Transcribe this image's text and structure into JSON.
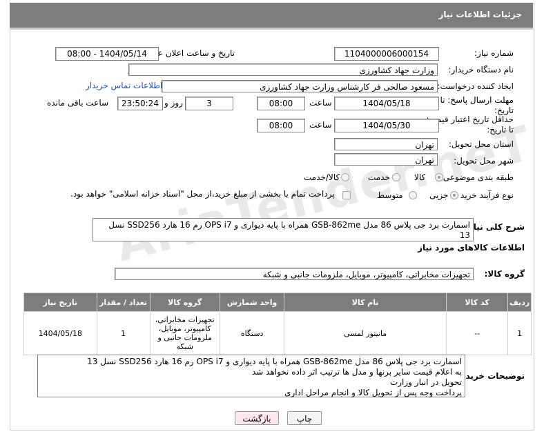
{
  "header": {
    "title": "جزئیات اطلاعات نیاز"
  },
  "watermark": "AriaTender.neT",
  "form": {
    "need_number_label": "شماره نیاز:",
    "need_number": "1104000006000154",
    "announce_label": "تاریخ و ساعت اعلان عمومی:",
    "announce_value": "1404/05/14 - 08:00",
    "buyer_org_label": "نام دستگاه خریدار:",
    "buyer_org": "وزارت جهاد کشاورزی",
    "creator_label": "ایجاد کننده درخواست:",
    "creator": "مسعود صالحی فر کارشناس وزارت جهاد کشاورزی",
    "contact_link": "اطلاعات تماس خریدار",
    "reply_deadline_label": "مهلت ارسال پاسخ: تا تاریخ:",
    "reply_date": "1404/05/18",
    "time_label": "ساعت",
    "reply_time": "08:00",
    "days_value": "3",
    "days_label": "روز و",
    "remaining_time": "23:50:24",
    "remaining_label": "ساعت باقی مانده",
    "price_deadline_label": "حداقل تاریخ اعتبار قیمت: تا تاریخ:",
    "price_date": "1404/05/30",
    "price_time": "08:00",
    "province_label": "استان محل تحویل:",
    "province": "تهران",
    "city_label": "شهر محل تحویل:",
    "city": "تهران",
    "category_label": "طبقه بندی موضوعی:",
    "category_options": [
      "کالا",
      "خدمت",
      "کالا/خدمت"
    ],
    "process_label": "نوع فرآیند خرید :",
    "process_options": [
      "جزیی",
      "متوسط"
    ],
    "payment_note": "پرداخت تمام یا بخشی از مبلغ خرید،از محل \"اسناد خزانه اسلامی\" خواهد بود."
  },
  "summary": {
    "label": "شرح کلی نیاز:",
    "text": "اسمارت برد جی پلاس 86 مدل GSB-862me همراه با پایه دیواری و OPS i7 رم 16 هارد SSD256 نسل 13"
  },
  "goods": {
    "section_title": "اطلاعات کالاهای مورد نیاز",
    "group_label": "گروه کالا:",
    "group_value": "تجهیزات مخابراتی، کامپیوتر، موبایل، ملزومات جانبی و شبکه",
    "columns": [
      "ردیف",
      "کد کالا",
      "نام کالا",
      "واحد شمارش",
      "گروه کالا",
      "تعداد / مقدار",
      "تاریخ نیاز"
    ],
    "rows": [
      {
        "row": "1",
        "code": "--",
        "name": "مانیتور لمسی",
        "unit": "دستگاه",
        "group": "تجهیزات مخابراتی، کامپیوتر، موبایل، ملزومات جانبی و شبکه",
        "qty": "1",
        "date": "1404/05/18"
      }
    ]
  },
  "buyer_notes": {
    "label": "توضیحات خریدار:",
    "lines": [
      "اسمارت برد جی پلاس 86 مدل GSB-862me همراه با پایه دیواری و OPS i7 رم 16 هارد SSD256 نسل 13",
      "به اعلام قیمت سایر برنها و مدل ها ترتیب اثر داده نخواهد شد",
      "تحویل در انبار وزارت",
      "پرداخت وجه پس از تحویل کالا و انجام مراحل اداری"
    ]
  },
  "buttons": {
    "print": "چاپ",
    "back": "بازگشت"
  }
}
